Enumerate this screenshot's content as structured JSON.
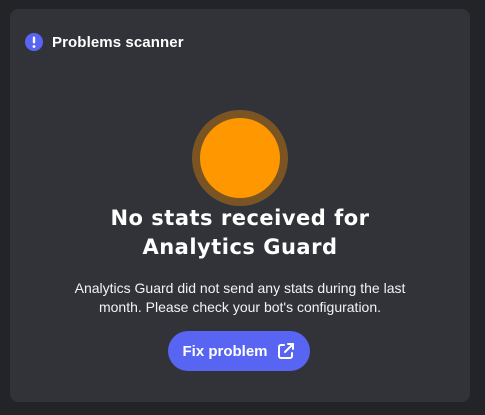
{
  "header": {
    "title": "Problems scanner",
    "icon": "info-icon",
    "icon_color": "#5865f2"
  },
  "status": {
    "indicator_color": "#ff9800",
    "indicator_halo_color": "#7a5523",
    "title_line1": "No stats received for",
    "title_line2": "Analytics Guard",
    "description_line1": "Analytics Guard did not send any stats during the last",
    "description_line2": "month. Please check your bot's configuration."
  },
  "action": {
    "label": "Fix problem",
    "icon": "external-link-icon",
    "color": "#5865f2"
  }
}
